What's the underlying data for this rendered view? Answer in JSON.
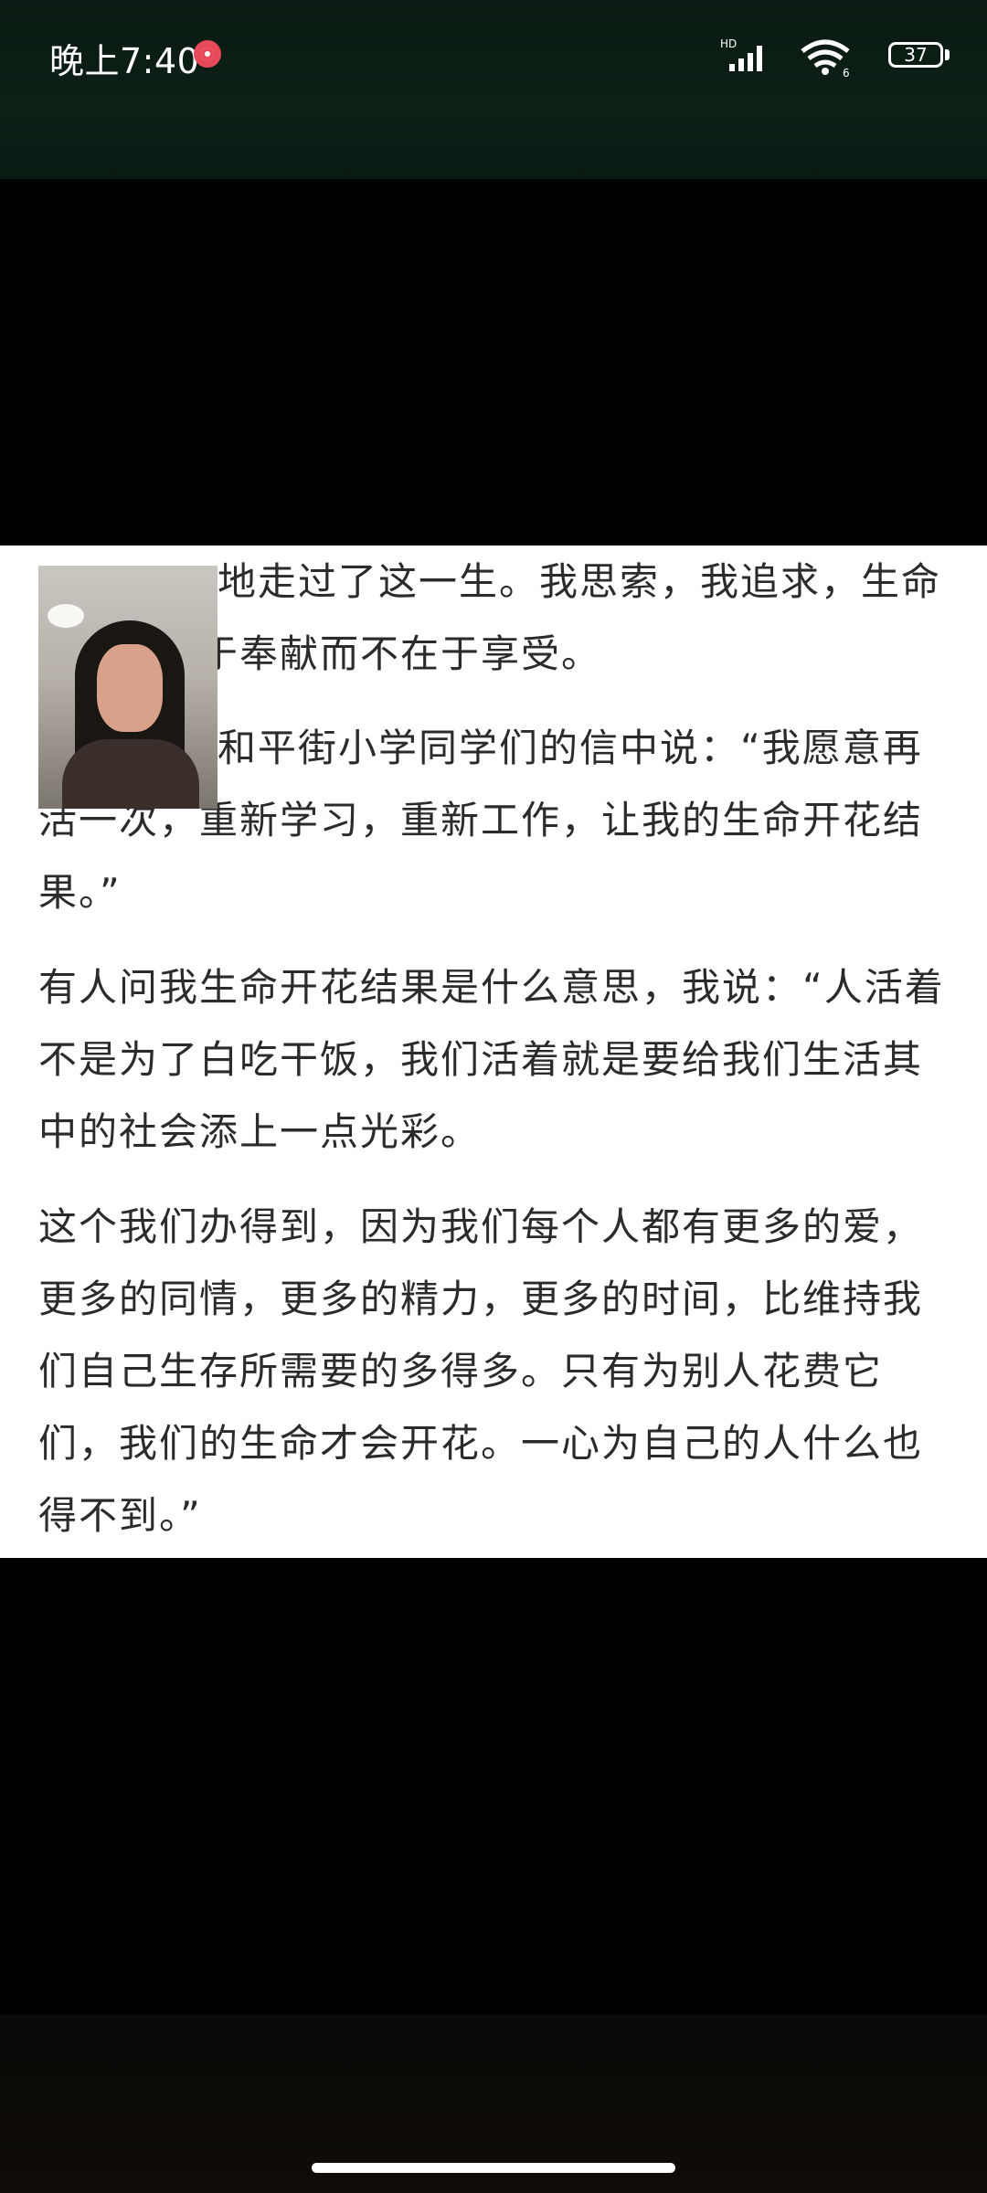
{
  "status_bar": {
    "time": "晚上7:40",
    "signal_label": "HD",
    "battery_level": "37",
    "icons": [
      "record-icon",
      "signal-icon",
      "wifi-icon",
      "battery-icon"
    ]
  },
  "video": {
    "paragraphs": [
      "地走过了这一生。我思索，我追求，生命的意义在于奉献而不在于享受。",
      "和平街小学同学们的信中说：“我愿意再活一次，重新学习，重新工作，让我的生命开花结果。”",
      "有人问我生命开花结果是什么意思，我说：“人活着不是为了白吃干饭，我们活着就是要给我们生活其中的社会添上一点光彩。",
      "这个我们办得到，因为我们每个人都有更多的爱，更多的同情，更多的精力，更多的时间，比维持我们自己生存所需要的多得多。只有为别人花费它们，我们的生命才会开花。一心为自己的人什么也得不到。”"
    ]
  }
}
